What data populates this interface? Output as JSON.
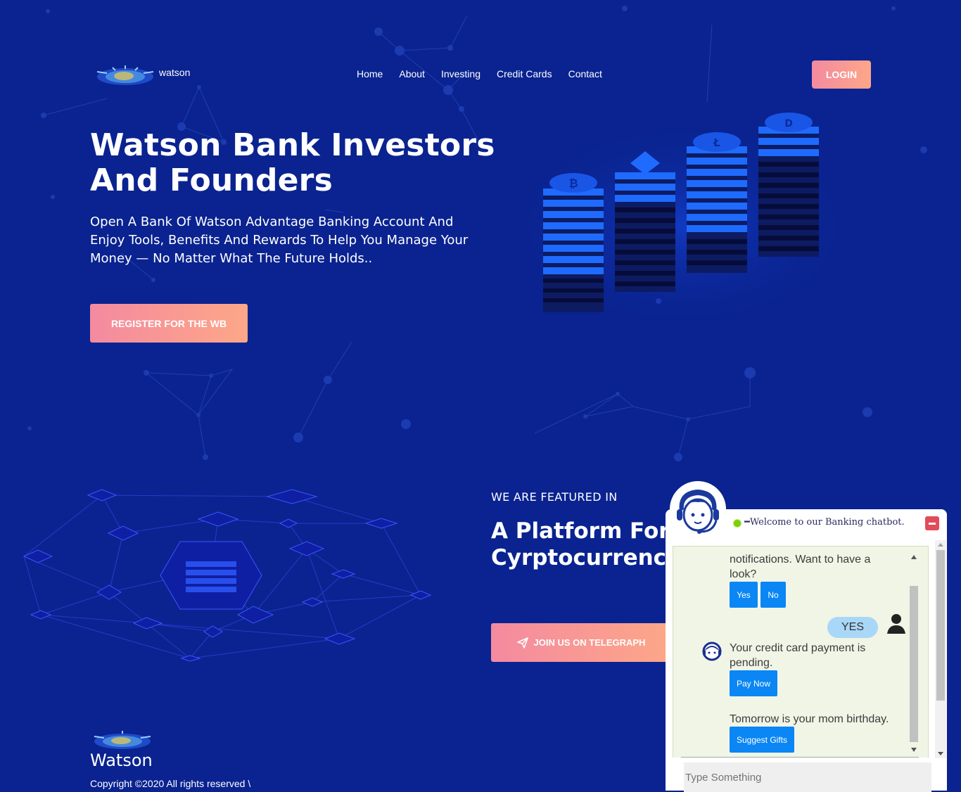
{
  "brand": {
    "logo_text": "watson",
    "footer_name": "Watson",
    "copyright": "Copyright ©2020 All rights reserved \\"
  },
  "nav": {
    "items": [
      "Home",
      "About",
      "Investing",
      "Credit Cards",
      "Contact"
    ],
    "login": "LOGIN"
  },
  "hero": {
    "title": "Watson Bank Investors And Founders",
    "subtitle": "Open A Bank Of Watson Advantage Banking Account And Enjoy Tools, Benefits And Rewards To Help You Manage Your Money — No Matter What The Future Holds..",
    "cta": "REGISTER FOR THE WB"
  },
  "featured": {
    "kicker": "WE ARE FEATURED IN",
    "title": "A Platform For Cyrptocurrency",
    "cta": "JOIN US ON TELEGRAPH"
  },
  "chatbot": {
    "title": "Welcome to our Banking chatbot.",
    "messages": {
      "m1": "notifications. Want to have a look?",
      "yes_btn": "Yes",
      "no_btn": "No",
      "user_reply": "YES",
      "m2": "Your credit card payment is pending.",
      "pay_btn": "Pay Now",
      "m3": "Tomorrow is your mom birthday.",
      "gift_btn": "Suggest Gifts"
    },
    "input_placeholder": "Type Something"
  },
  "colors": {
    "background": "#0a2390",
    "accent_gradient_start": "#f48aa0",
    "accent_gradient_end": "#fda788",
    "chat_button": "#0a86f5"
  }
}
